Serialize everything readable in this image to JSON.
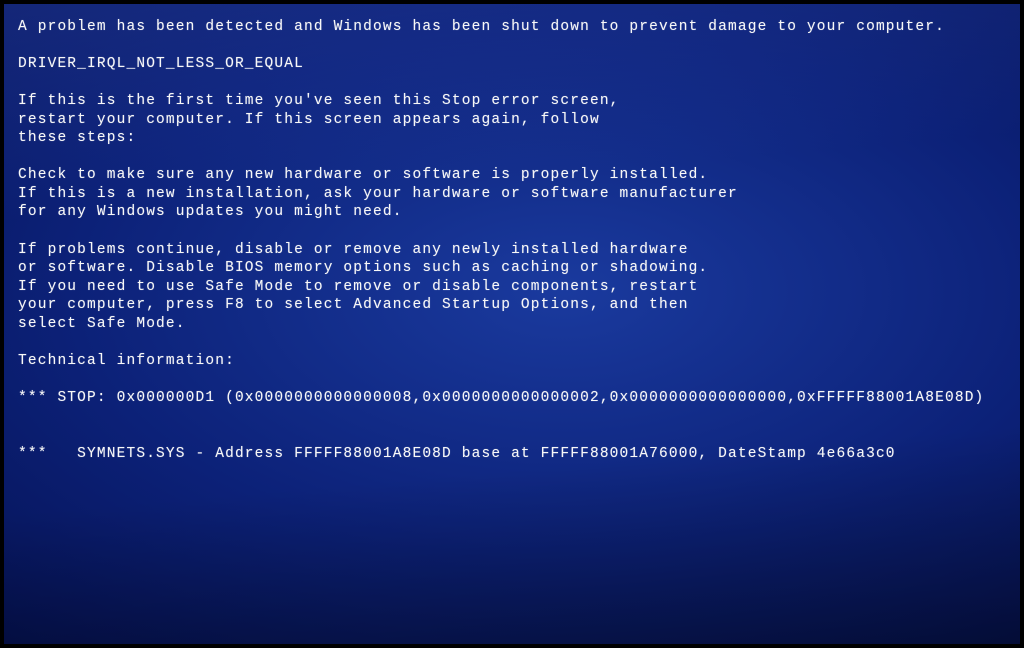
{
  "lines": {
    "l1": "A problem has been detected and Windows has been shut down to prevent damage to your computer.",
    "l2": "DRIVER_IRQL_NOT_LESS_OR_EQUAL",
    "l3": "If this is the first time you've seen this Stop error screen,\nrestart your computer. If this screen appears again, follow\nthese steps:",
    "l4": "Check to make sure any new hardware or software is properly installed.\nIf this is a new installation, ask your hardware or software manufacturer\nfor any Windows updates you might need.",
    "l5": "If problems continue, disable or remove any newly installed hardware\nor software. Disable BIOS memory options such as caching or shadowing.\nIf you need to use Safe Mode to remove or disable components, restart\nyour computer, press F8 to select Advanced Startup Options, and then\nselect Safe Mode.",
    "l6": "Technical information:",
    "l7": "*** STOP: 0x000000D1 (0x0000000000000008,0x0000000000000002,0x0000000000000000,0xFFFFF88001A8E08D)",
    "l8": "***   SYMNETS.SYS - Address FFFFF88001A8E08D base at FFFFF88001A76000, DateStamp 4e66a3c0"
  },
  "error_details": {
    "stop_code": "0x000000D1",
    "error_name": "DRIVER_IRQL_NOT_LESS_OR_EQUAL",
    "parameters": [
      "0x0000000000000008",
      "0x0000000000000002",
      "0x0000000000000000",
      "0xFFFFF88001A8E08D"
    ],
    "module": "SYMNETS.SYS",
    "address": "FFFFF88001A8E08D",
    "base": "FFFFF88001A76000",
    "datestamp": "4e66a3c0"
  }
}
